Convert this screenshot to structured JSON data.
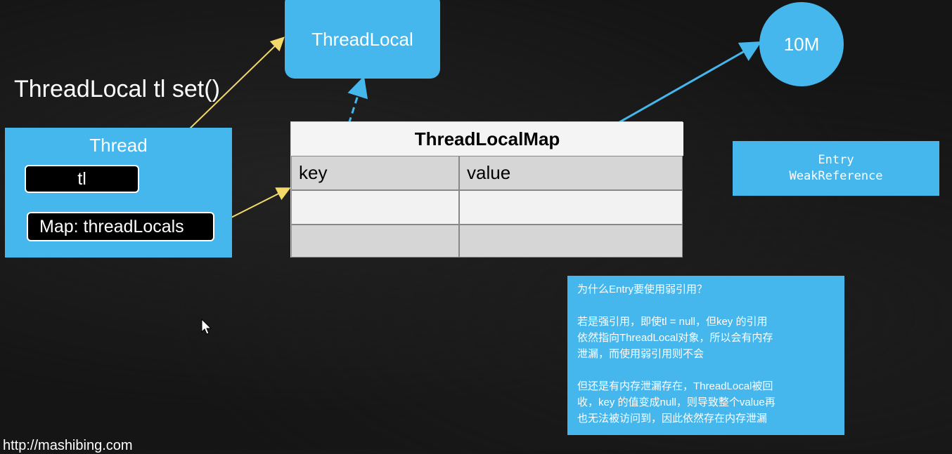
{
  "heading": "ThreadLocal tl set()",
  "threadlocal_label": "ThreadLocal",
  "memory_label": "10M",
  "thread": {
    "title": "Thread",
    "tl_field": "tl",
    "map_field": "Map: threadLocals"
  },
  "map": {
    "title": "ThreadLocalMap",
    "key_label": "key",
    "value_label": "value"
  },
  "entry": {
    "line1": "Entry",
    "line2": "WeakReference"
  },
  "note": {
    "question": "为什么Entry要使用弱引用？",
    "para1_l1": "若是强引用，即使tl = null，但key 的引用",
    "para1_l2": "依然指向ThreadLocal对象，所以会有内存",
    "para1_l3": "泄漏，而使用弱引用则不会",
    "para2_l1": "但还是有内存泄漏存在，ThreadLocal被回",
    "para2_l2": "收，key 的值变成null，则导致整个value再",
    "para2_l3": "也无法被访问到，因此依然存在内存泄漏"
  },
  "url": "http://mashibing.com",
  "colors": {
    "box_blue": "#45b7ec",
    "arrow_yellow": "#f2d96a",
    "arrow_blue": "#45b7ec",
    "background": "#151515"
  }
}
